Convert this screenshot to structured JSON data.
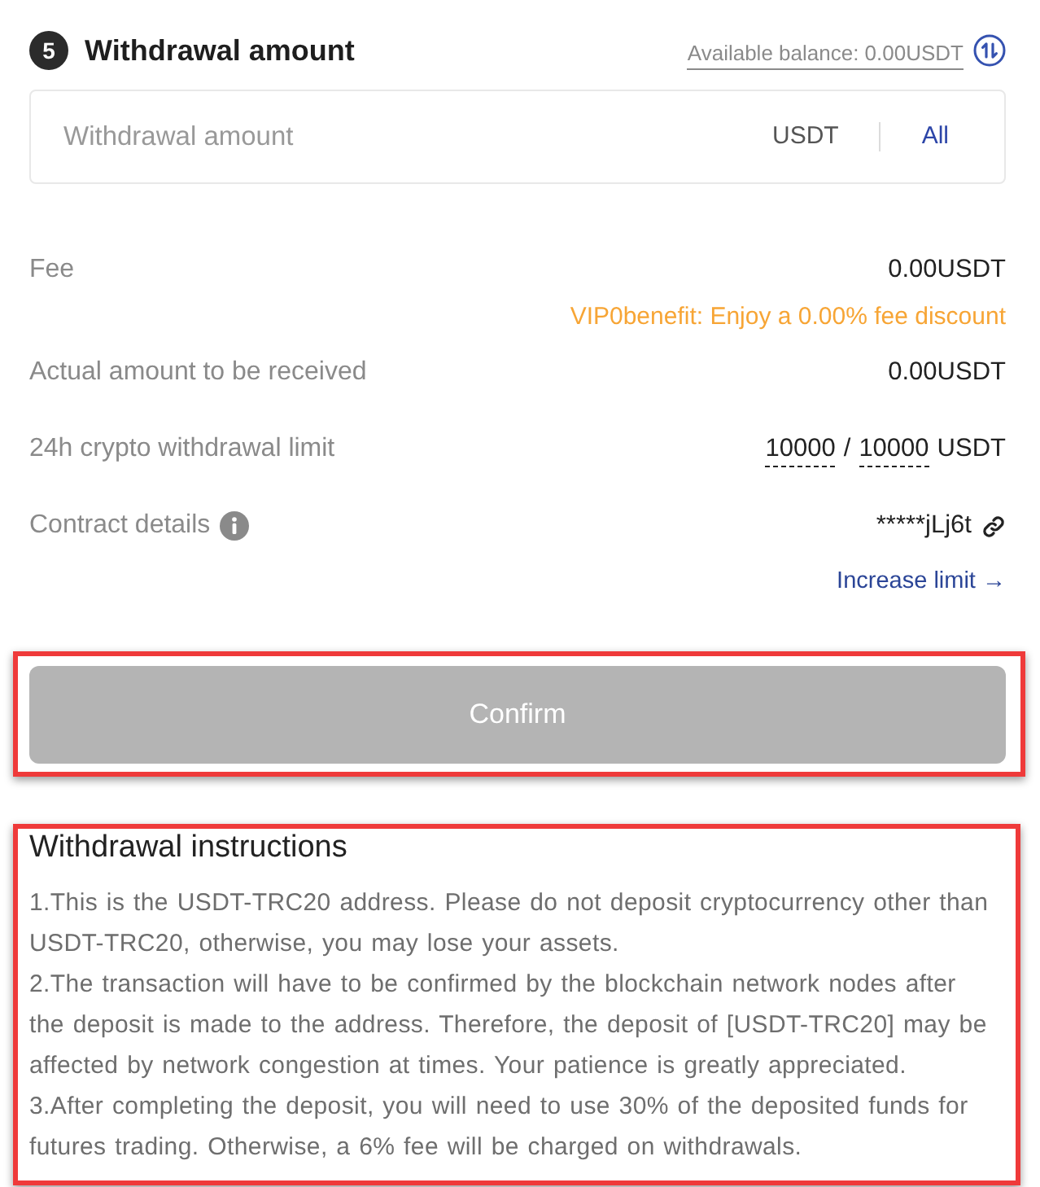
{
  "section": {
    "step": "5",
    "title": "Withdrawal amount",
    "balance_link": "Available balance: 0.00USDT"
  },
  "amount_field": {
    "placeholder": "Withdrawal amount",
    "currency": "USDT",
    "all_button": "All"
  },
  "details": [
    {
      "kind": "value",
      "label": "Fee",
      "value": "0.00USDT",
      "note": "VIP0benefit: Enjoy a 0.00% fee discount"
    },
    {
      "kind": "value",
      "label": "Actual amount to be received",
      "value": "0.00USDT"
    },
    {
      "kind": "limit",
      "label": "24h crypto withdrawal limit",
      "used": "10000",
      "separator": "/",
      "total": "10000",
      "unit": "USDT"
    },
    {
      "kind": "contract",
      "label": "Contract details",
      "value": "*****jLj6t"
    }
  ],
  "increase_limit_link": "Increase limit →",
  "confirm": {
    "label": "Confirm",
    "disabled": true,
    "highlighted": true
  },
  "instructions": {
    "title": "Withdrawal instructions",
    "highlighted": true,
    "items": [
      "1.This is the USDT-TRC20 address. Please do not deposit cryptocurrency other than USDT-TRC20, otherwise, you may lose your assets.",
      "2.The transaction will have to be confirmed by the blockchain network nodes after the deposit is made to the address. Therefore, the deposit of [USDT-TRC20] may be affected by network congestion at times. Your patience is greatly appreciated.",
      "3.After completing the deposit, you will need to use 30% of the deposited funds for futures trading. Otherwise, a 6% fee will be charged on withdrawals."
    ]
  }
}
